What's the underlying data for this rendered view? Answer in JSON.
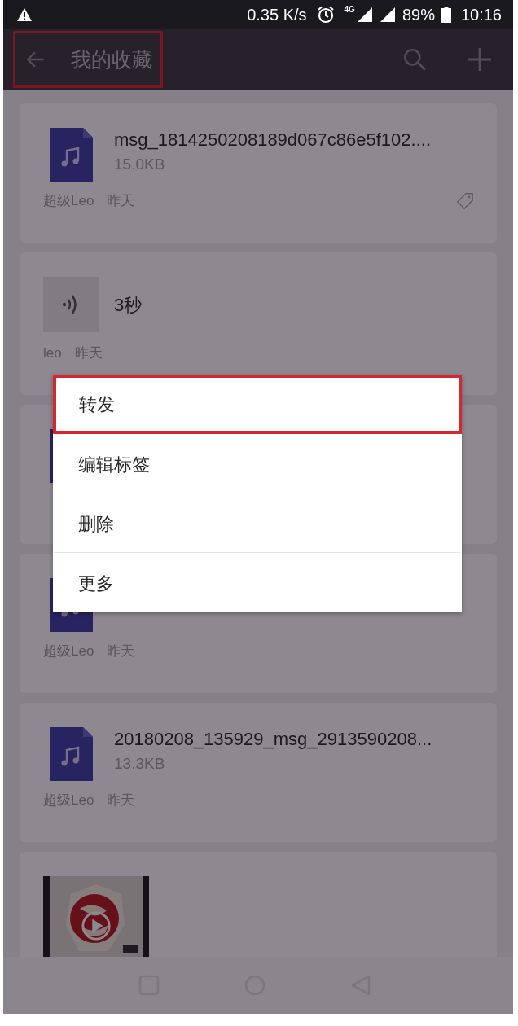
{
  "status_bar": {
    "net_speed": "0.35 K/s",
    "network": "4G",
    "battery": "89%",
    "time": "10:16"
  },
  "app_bar": {
    "title": "我的收藏",
    "highlighted": true
  },
  "items": [
    {
      "kind": "file",
      "title": "msg_1814250208189d067c86e5f102....",
      "size": "15.0KB",
      "author": "超级Leo",
      "time": "昨天",
      "tagged": true
    },
    {
      "kind": "voice",
      "duration": "3秒",
      "author": "leo",
      "time": "昨天",
      "tagged": false
    },
    {
      "kind": "file",
      "tagged": false
    },
    {
      "kind": "file",
      "author": "超级Leo",
      "time": "昨天",
      "tagged": false
    },
    {
      "kind": "file",
      "title": "20180208_135929_msg_2913590208...",
      "size": "13.3KB",
      "author": "超级Leo",
      "time": "昨天",
      "tagged": false
    },
    {
      "kind": "video",
      "tagged": false
    }
  ],
  "context_menu": [
    {
      "label": "转发",
      "highlighted": true
    },
    {
      "label": "编辑标签",
      "highlighted": false
    },
    {
      "label": "删除",
      "highlighted": false
    },
    {
      "label": "更多",
      "highlighted": false
    }
  ]
}
